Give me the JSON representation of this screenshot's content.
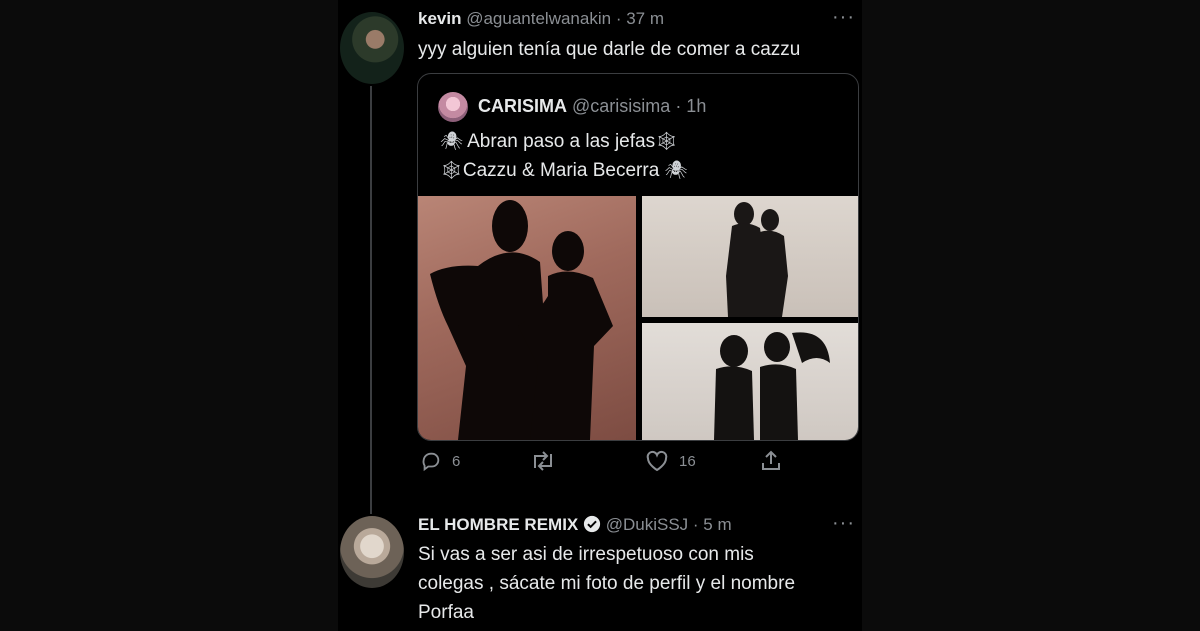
{
  "tweet1": {
    "name": "kevin",
    "handle": "@aguantelwanakin",
    "time": "· 37 m",
    "more": "···",
    "text": "yyy alguien tenía que darle de comer a cazzu"
  },
  "quote": {
    "name": "CARISIMA",
    "handle": "@carisisima",
    "time": "· 1h",
    "line1": "Abran paso a las jefas",
    "line2": "Cazzu & Maria Becerra",
    "icon_spider": "🕷",
    "icon_web": "🕸"
  },
  "actions": {
    "replies": "6",
    "likes": "16"
  },
  "tweet2": {
    "name": "EL HOMBRE REMIX",
    "handle": "@DukiSSJ",
    "time": "· 5 m",
    "more": "···",
    "text_line1": "Si vas a ser asi de irrespetuoso con mis",
    "text_line2": "colegas , sácate mi foto de perfil y el nombre",
    "text_line3": "Porfaa"
  }
}
